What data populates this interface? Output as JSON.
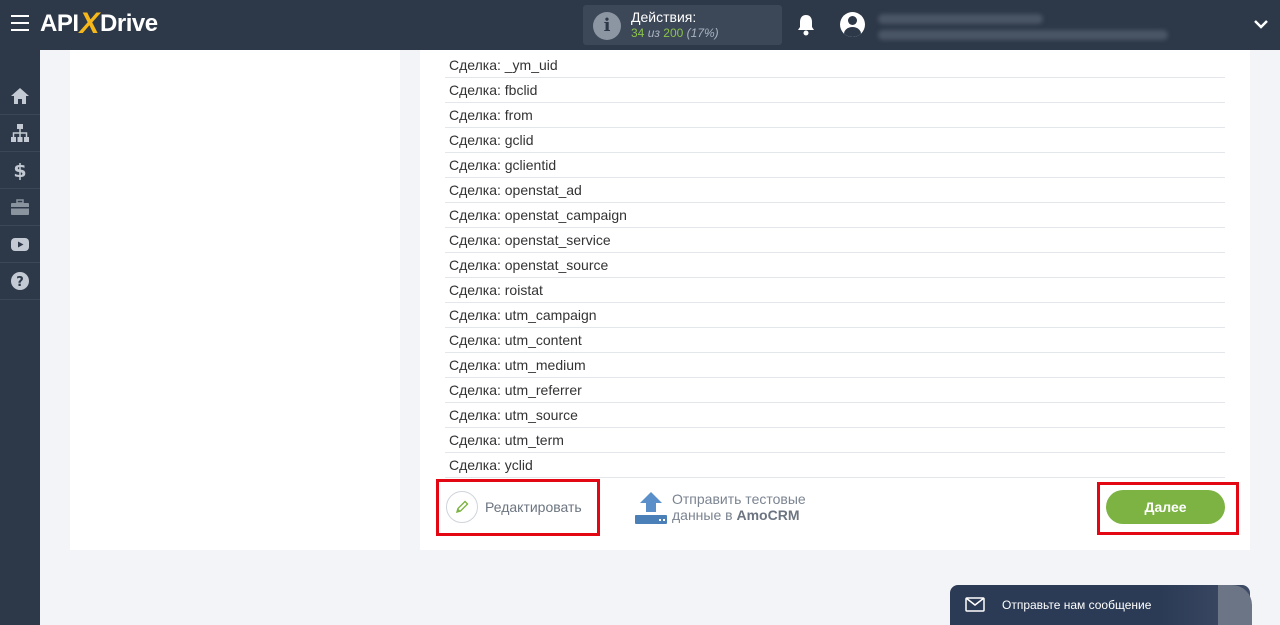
{
  "header": {
    "logo": {
      "part1": "API",
      "part2": "X",
      "part3": "Drive"
    },
    "actions": {
      "title": "Действия:",
      "used": "34",
      "sep": " из ",
      "total": "200",
      "percent": " (17%)"
    }
  },
  "icons": {
    "hamburger": "menu-icon",
    "info": "info-icon",
    "bell": "bell-icon",
    "user": "user-icon",
    "chevron": "chevron-down-icon"
  },
  "sidebar": {
    "items": [
      "home-icon",
      "sitemap-icon",
      "dollar-icon",
      "briefcase-icon",
      "youtube-icon",
      "help-icon"
    ]
  },
  "fields": [
    "Сделка: _ym_uid",
    "Сделка: fbclid",
    "Сделка: from",
    "Сделка: gclid",
    "Сделка: gclientid",
    "Сделка: openstat_ad",
    "Сделка: openstat_campaign",
    "Сделка: openstat_service",
    "Сделка: openstat_source",
    "Сделка: roistat",
    "Сделка: utm_campaign",
    "Сделка: utm_content",
    "Сделка: utm_medium",
    "Сделка: utm_referrer",
    "Сделка: utm_source",
    "Сделка: utm_term",
    "Сделка: yclid"
  ],
  "buttons": {
    "edit": "Редактировать",
    "send_line1": "Отправить тестовые",
    "send_line2_prefix": "данные в ",
    "send_line2_app": "AmoCRM",
    "next": "Далее"
  },
  "chat": {
    "label": "Отправьте нам сообщение"
  },
  "colors": {
    "topbar": "#2d3848",
    "accent": "#7cb342",
    "highlight": "#e30613",
    "logo_x": "#f5b71a"
  }
}
